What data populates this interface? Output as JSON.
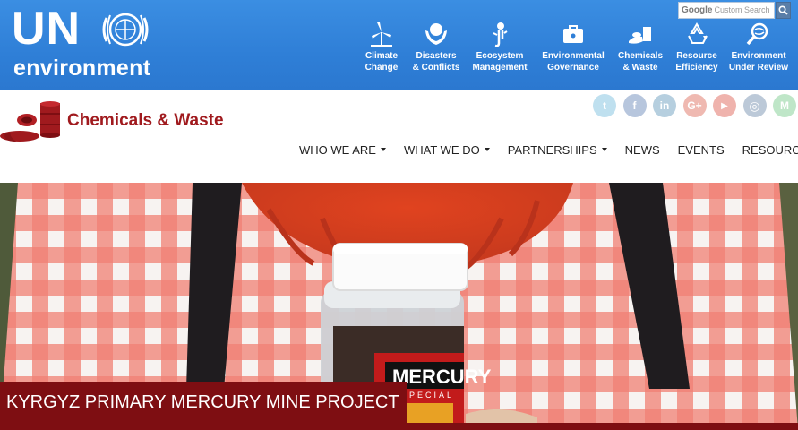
{
  "header": {
    "logo": {
      "top": "UN",
      "bottom": "environment"
    },
    "search": {
      "brand": "Google",
      "placeholder": "Custom Search"
    },
    "topics": [
      {
        "label": "Climate\nChange",
        "icon": "wind-turbine-icon"
      },
      {
        "label": "Disasters\n& Conflicts",
        "icon": "hands-globe-icon"
      },
      {
        "label": "Ecosystem\nManagement",
        "icon": "ecosystem-icon"
      },
      {
        "label": "Environmental\nGovernance",
        "icon": "briefcase-icon"
      },
      {
        "label": "Chemicals\n& Waste",
        "icon": "spill-icon"
      },
      {
        "label": "Resource\nEfficiency",
        "icon": "recycle-icon"
      },
      {
        "label": "Environment\nUnder Review",
        "icon": "magnifier-globe-icon"
      }
    ]
  },
  "site": {
    "title": "Chemicals & Waste"
  },
  "social": [
    {
      "name": "twitter-icon",
      "glyph": "t",
      "color": "#bfe0ef"
    },
    {
      "name": "facebook-icon",
      "glyph": "f",
      "color": "#b7c6dd"
    },
    {
      "name": "linkedin-icon",
      "glyph": "in",
      "color": "#b6cfdf"
    },
    {
      "name": "google-plus-icon",
      "glyph": "G+",
      "color": "#efb9b1"
    },
    {
      "name": "youtube-icon",
      "glyph": "▶",
      "color": "#efb3ad"
    },
    {
      "name": "instagram-icon",
      "glyph": "◎",
      "color": "#bcc9d8"
    },
    {
      "name": "medium-icon",
      "glyph": "M",
      "color": "#bfe6c8"
    }
  ],
  "nav": [
    {
      "label": "WHO WE ARE",
      "dropdown": true
    },
    {
      "label": "WHAT WE DO",
      "dropdown": true
    },
    {
      "label": "PARTNERSHIPS",
      "dropdown": true
    },
    {
      "label": "NEWS",
      "dropdown": false
    },
    {
      "label": "EVENTS",
      "dropdown": false
    },
    {
      "label": "RESOURCES",
      "dropdown": true
    }
  ],
  "hero": {
    "caption": "KYRGYZ PRIMARY MERCURY MINE PROJECT"
  },
  "colors": {
    "brand_red": "#a01a1e",
    "caption_bg": "#7e0e12",
    "top_blue": "#2f7fd7"
  }
}
